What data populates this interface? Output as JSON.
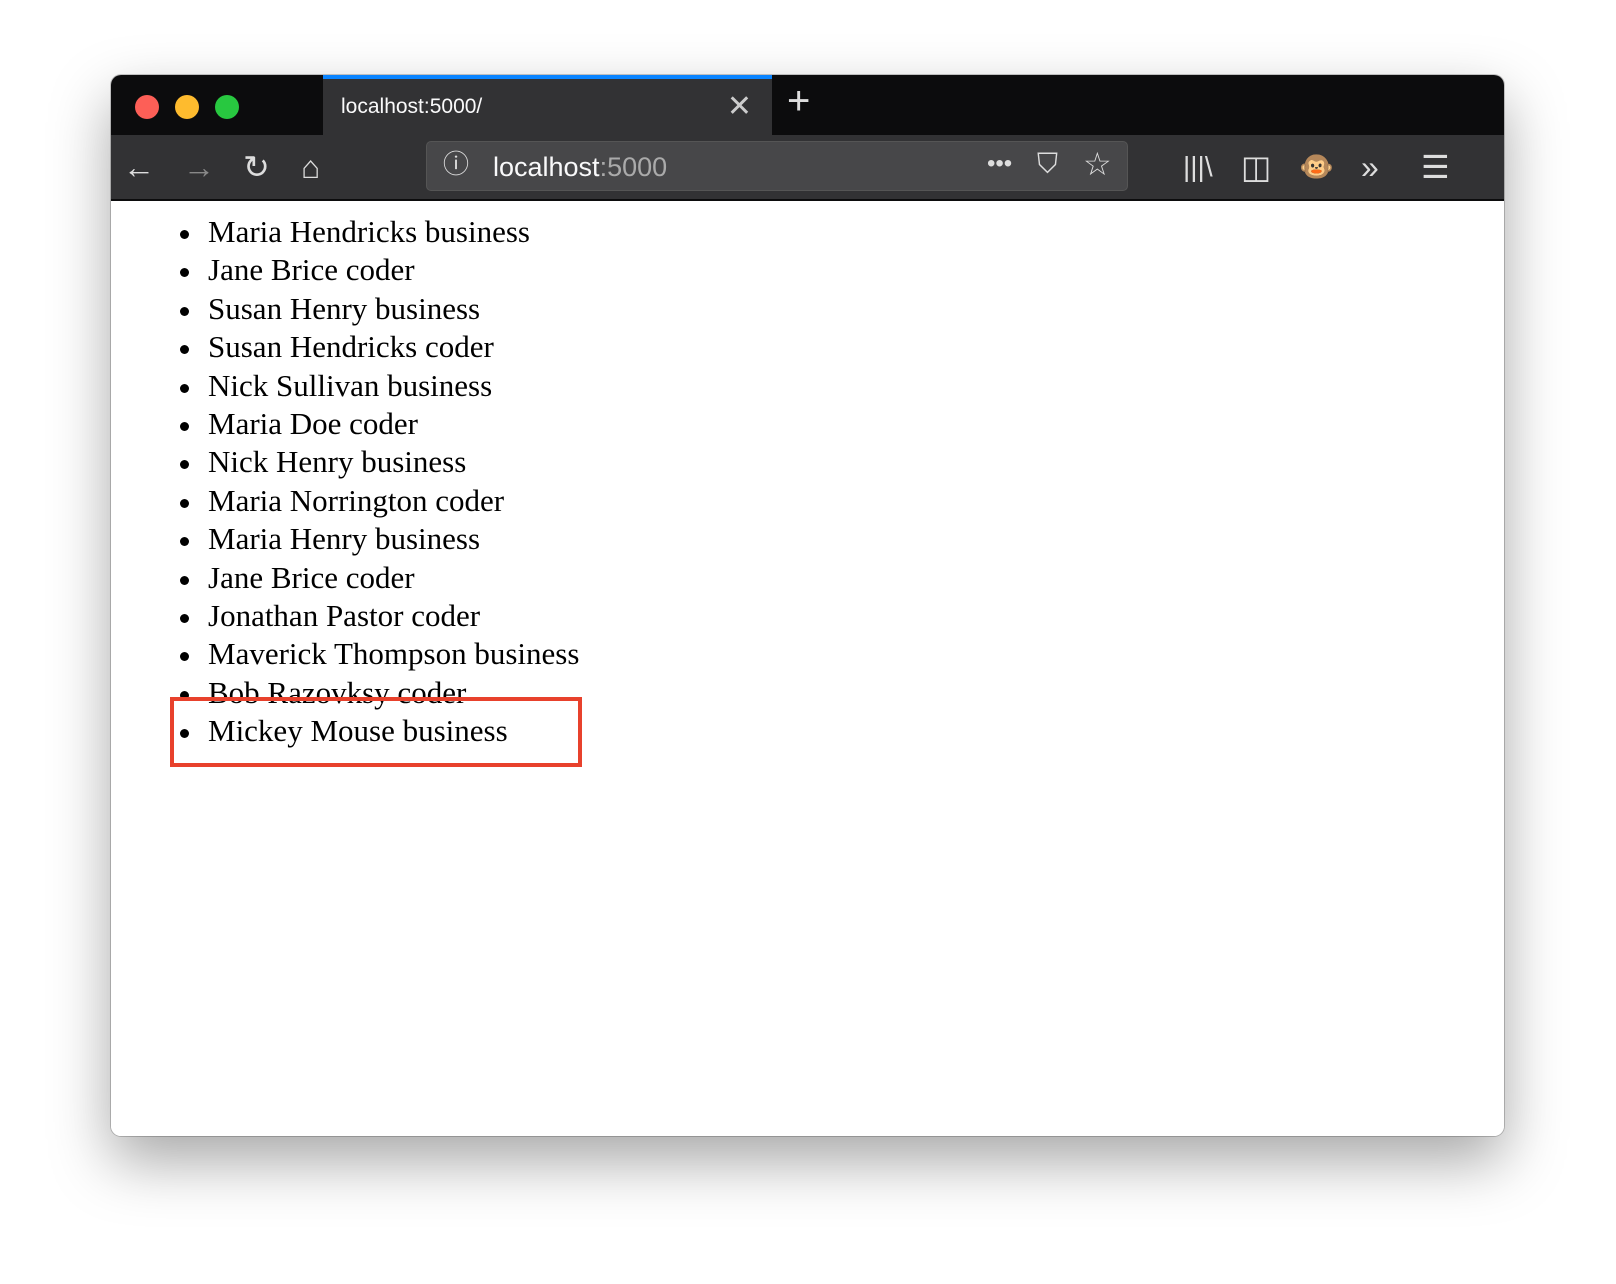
{
  "browser": {
    "tab_title": "localhost:5000/",
    "url_host": "localhost",
    "url_port": ":5000",
    "icons": [
      "back-icon",
      "forward-icon",
      "reload-icon",
      "home-icon",
      "info-icon",
      "more-icon",
      "pocket-icon",
      "star-icon",
      "library-icon",
      "sidebar-icon",
      "monkey-extension-icon",
      "overflow-icon",
      "menu-icon"
    ]
  },
  "list": [
    "Maria Hendricks business",
    "Jane Brice coder",
    "Susan Henry business",
    "Susan Hendricks coder",
    "Nick Sullivan business",
    "Maria Doe coder",
    "Nick Henry business",
    "Maria Norrington coder",
    "Maria Henry business",
    "Jane Brice coder",
    "Jonathan Pastor coder",
    "Maverick Thompson business",
    "Bob Razovksy coder",
    "Mickey Mouse business"
  ],
  "highlight_color": "#e8412c"
}
